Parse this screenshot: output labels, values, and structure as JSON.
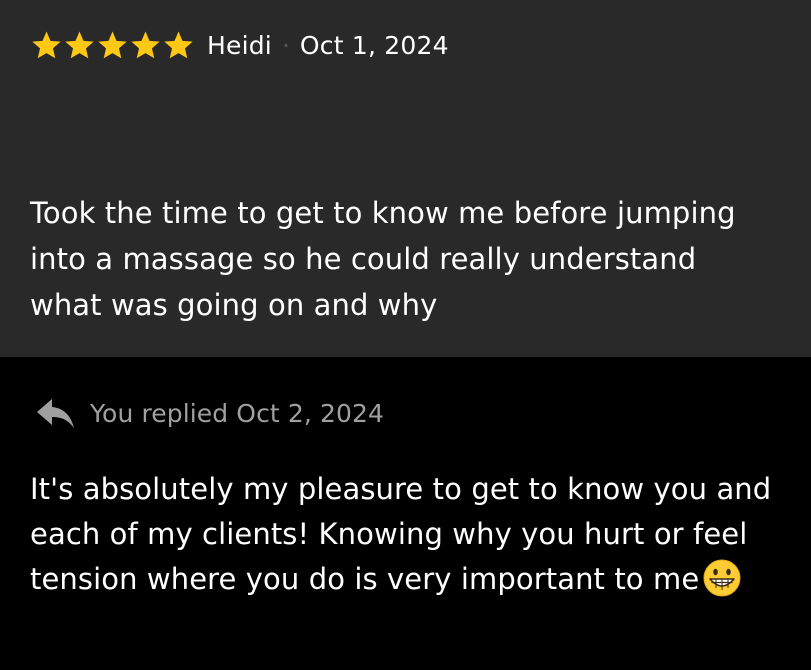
{
  "review": {
    "rating": 5,
    "max_rating": 5,
    "star_color": "#FFC814",
    "reviewer_name": "Heidi",
    "separator": "·",
    "date": "Oct 1, 2024",
    "text": "Took the time to get to know me before jumping into a massage so he could really understand what was going on and why"
  },
  "reply": {
    "icon": "reply-arrow-icon",
    "meta": "You replied Oct 2, 2024",
    "text": "It's absolutely my pleasure to get to know you and each of my clients! Knowing why you hurt or feel tension where you do is very important to me",
    "emoji": "grinning-face-emoji"
  },
  "colors": {
    "review_background": "#292929",
    "reply_background": "#000000",
    "meta_text": "#A0A0A0",
    "primary_text": "#FFFFFF"
  }
}
